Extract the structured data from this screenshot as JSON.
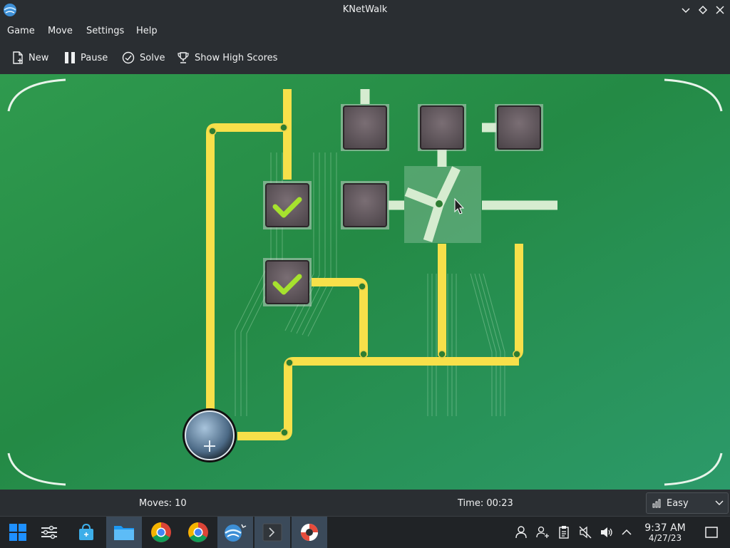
{
  "window": {
    "title": "KNetWalk"
  },
  "menu": {
    "items": [
      {
        "label": "Game"
      },
      {
        "label": "Move"
      },
      {
        "label": "Settings"
      },
      {
        "label": "Help"
      }
    ]
  },
  "toolbar": {
    "new_label": "New",
    "pause_label": "Pause",
    "solve_label": "Solve",
    "highscores_label": "Show High Scores"
  },
  "status": {
    "moves": "Moves: 10",
    "time": "Time: 00:23",
    "difficulty": "Easy"
  },
  "taskbar": {
    "time": "9:37 AM",
    "date": "4/27/23",
    "apps": [
      "start-menu",
      "system-settings",
      "discover",
      "dolphin-file-manager",
      "chrome",
      "chrome",
      "knetwalk",
      "konsole",
      "help-center"
    ]
  },
  "colors": {
    "board": "#2e8b57",
    "cable_connected": "#f7e04a",
    "cable_disconnected": "#cfe6c9",
    "chrome": "#2a2e32",
    "accent": "#3daee9"
  }
}
